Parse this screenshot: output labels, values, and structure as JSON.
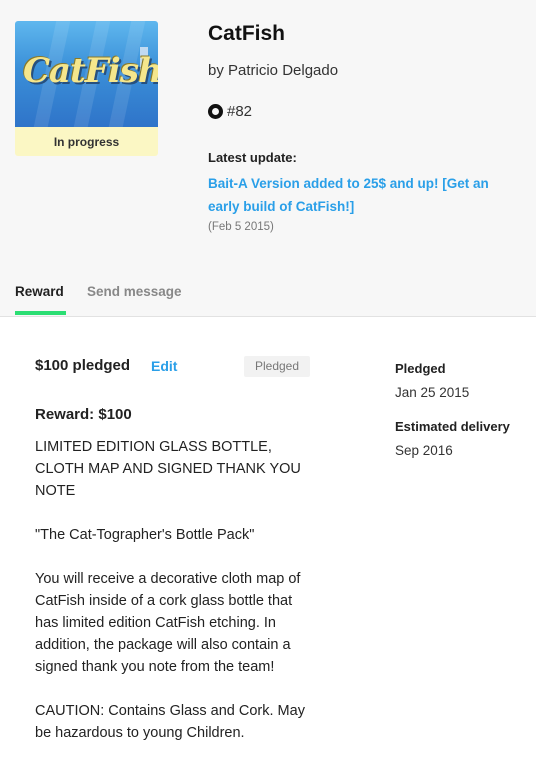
{
  "project": {
    "title": "CatFish",
    "creator": "by Patricio Delgado",
    "backer_number": "#82",
    "thumbnail_logo": "CatFish",
    "status": "In progress"
  },
  "update": {
    "label": "Latest update:",
    "link_text": "Bait-A Version added to 25$ and up! [Get an early build of CatFish!]",
    "date": "(Feb 5 2015)"
  },
  "tabs": [
    {
      "label": "Reward",
      "active": true
    },
    {
      "label": "Send message",
      "active": false
    }
  ],
  "pledge": {
    "amount": "$100 pledged",
    "edit_label": "Edit",
    "status_pill": "Pledged"
  },
  "reward": {
    "title": "Reward: $100",
    "paragraphs": [
      "LIMITED EDITION GLASS BOTTLE, CLOTH MAP AND SIGNED THANK YOU NOTE",
      "\"The Cat-Tographer's Bottle Pack\"",
      "You will receive a decorative cloth map of CatFish inside of a cork glass bottle that has limited edition CatFish etching. In addition, the package will also contain a signed thank you note from the team!",
      "CAUTION: Contains Glass and Cork. May be hazardous to young Children."
    ]
  },
  "sidebar": {
    "pledged_label": "Pledged",
    "pledged_date": "Jan 25 2015",
    "delivery_label": "Estimated delivery",
    "delivery_date": "Sep 2016"
  },
  "colors": {
    "accent_link": "#2a9fe8",
    "tab_underline": "#2bde73",
    "status_bg": "#fbf7c4"
  }
}
